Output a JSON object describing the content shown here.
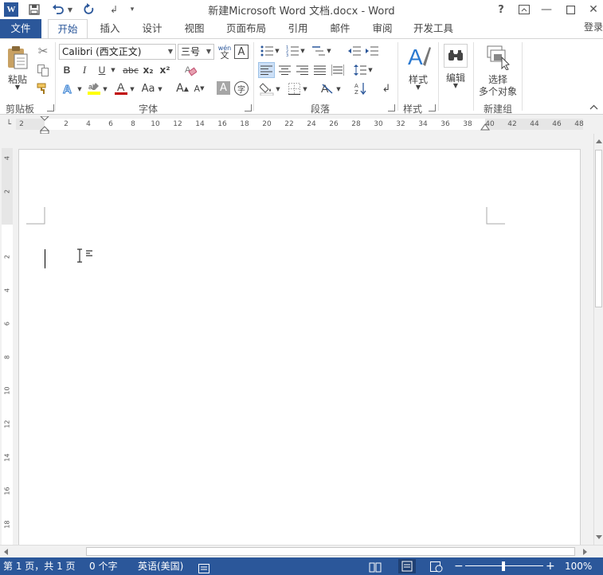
{
  "window": {
    "title": "新建Microsoft Word 文档.docx - Word",
    "logo_letter": "W"
  },
  "tabs": {
    "file": "文件",
    "items": [
      "开始",
      "插入",
      "设计",
      "视图",
      "页面布局",
      "引用",
      "邮件",
      "审阅",
      "开发工具"
    ],
    "login": "登录"
  },
  "ribbon": {
    "clipboard": {
      "paste": "粘贴",
      "label": "剪贴板"
    },
    "font": {
      "font_name": "Calibri (西文正文)",
      "font_size": "三号",
      "bold": "B",
      "italic": "I",
      "underline": "U",
      "strike": "abc",
      "subscript": "x₂",
      "superscript": "x²",
      "change_case": "Aa",
      "grow": "A",
      "shrink": "A",
      "font_color_letter": "A",
      "text_effect_letter": "A",
      "char_shading": "A",
      "enclose": "字",
      "phonetic_top": "wén",
      "phonetic_bottom": "文",
      "label": "字体"
    },
    "paragraph": {
      "label": "段落"
    },
    "styles": {
      "button": "样式",
      "label": "样式"
    },
    "editing": {
      "button": "编辑"
    },
    "newgroup": {
      "line1": "选择",
      "line2": "多个对象",
      "label": "新建组"
    }
  },
  "ruler": {
    "ticks": [
      "2",
      "2",
      "4",
      "6",
      "8",
      "10",
      "12",
      "14",
      "16",
      "18",
      "20",
      "22",
      "24",
      "26",
      "28",
      "30",
      "32",
      "34",
      "36",
      "38",
      "40",
      "42",
      "44",
      "46",
      "48"
    ]
  },
  "vruler": {
    "ticks": [
      "4",
      "2",
      "2",
      "4",
      "6",
      "8",
      "10",
      "12",
      "14",
      "16",
      "18"
    ]
  },
  "status": {
    "page": "第 1 页，共 1 页",
    "words": "0 个字",
    "language": "英语(美国)",
    "zoom": "100%"
  },
  "colors": {
    "accent": "#2b579a",
    "font_color": "#c00000",
    "highlight": "#ffff00"
  }
}
